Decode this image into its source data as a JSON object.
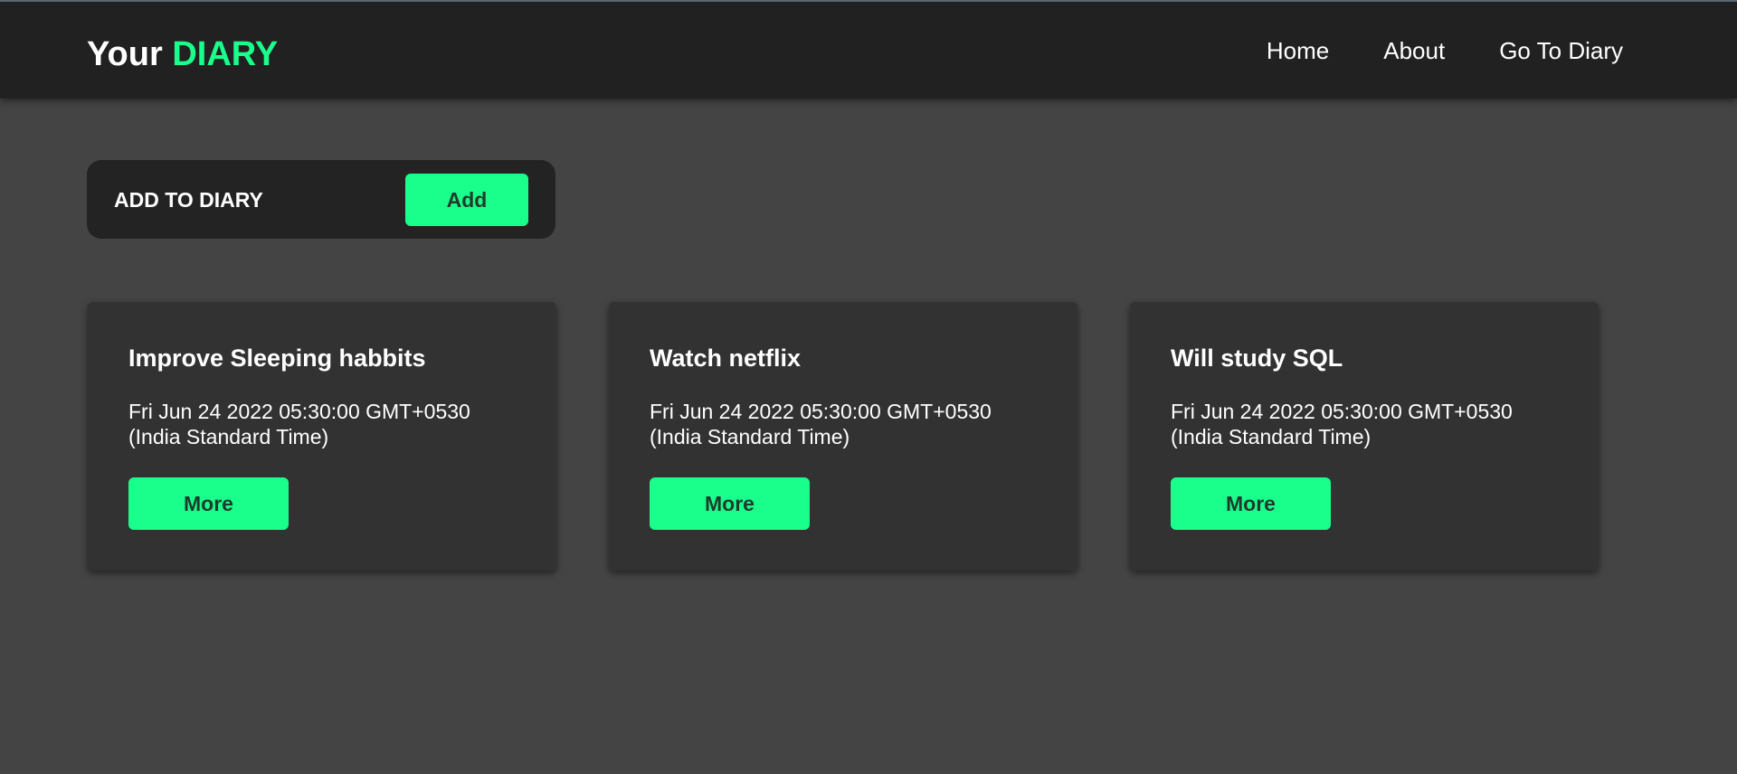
{
  "header": {
    "brand_prefix": "Your",
    "brand_accent": "DIARY",
    "nav": [
      {
        "label": "Home"
      },
      {
        "label": "About"
      },
      {
        "label": "Go To Diary"
      }
    ]
  },
  "add_panel": {
    "label": "ADD TO DIARY",
    "button_label": "Add"
  },
  "cards": [
    {
      "title": "Improve Sleeping habbits",
      "date": "Fri Jun 24 2022 05:30:00 GMT+0530 (India Standard Time)",
      "button_label": "More"
    },
    {
      "title": "Watch netflix",
      "date": "Fri Jun 24 2022 05:30:00 GMT+0530 (India Standard Time)",
      "button_label": "More"
    },
    {
      "title": "Will study SQL",
      "date": "Fri Jun 24 2022 05:30:00 GMT+0530 (India Standard Time)",
      "button_label": "More"
    }
  ],
  "colors": {
    "accent": "#1aff8c",
    "navbar_bg": "#212121",
    "page_bg": "#444444",
    "card_bg": "#323232",
    "button_text": "#1f3a2b"
  }
}
